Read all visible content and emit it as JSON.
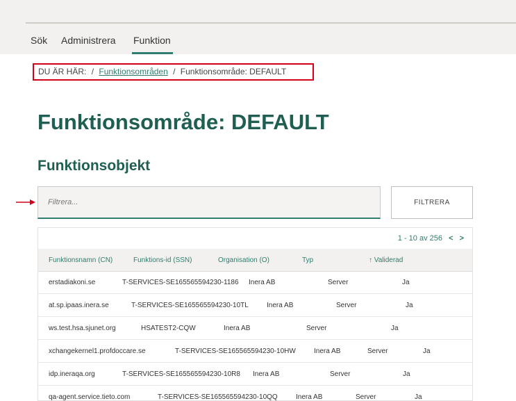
{
  "nav": {
    "items": [
      "Sök",
      "Administrera",
      "Funktion"
    ],
    "active": "Funktion"
  },
  "breadcrumb": {
    "prefix": "DU ÄR HÄR:",
    "separator": "/",
    "link": "Funktionsområden",
    "current": "Funktionsområde: DEFAULT"
  },
  "page": {
    "title": "Funktionsområde: DEFAULT",
    "section_title": "Funktionsobjekt"
  },
  "filter": {
    "placeholder": "Filtrera...",
    "button_label": "FILTRERA"
  },
  "pagination": {
    "label": "1 - 10 av 256",
    "prev": "<",
    "next": ">"
  },
  "table": {
    "columns": [
      "Funktionsnamn (CN)",
      "Funktions-id (SSN)",
      "Organisation (O)",
      "Typ",
      "Validerad"
    ],
    "sort_indicator": "↑",
    "rows": [
      [
        "erstadiakoni.se",
        "T-SERVICES-SE165565594230-1186",
        "Inera AB",
        "Server",
        "Ja"
      ],
      [
        "at.sp.ipaas.inera.se",
        "T-SERVICES-SE165565594230-10TL",
        "Inera AB",
        "Server",
        "Ja"
      ],
      [
        "ws.test.hsa.sjunet.org",
        "HSATEST2-CQW",
        "Inera AB",
        "Server",
        "Ja"
      ],
      [
        "xchangekernel1.profdoccare.se",
        "T-SERVICES-SE165565594230-10HW",
        "Inera AB",
        "Server",
        "Ja"
      ],
      [
        "idp.ineraqa.org",
        "T-SERVICES-SE165565594230-10R8",
        "Inera AB",
        "Server",
        "Ja"
      ],
      [
        "qa-agent.service.tieto.com",
        "T-SERVICES-SE165565594230-10QQ",
        "Inera AB",
        "Server",
        "Ja"
      ]
    ]
  },
  "colors": {
    "accent": "#2e7d6e",
    "heading": "#1f5f52",
    "highlight": "#d4001a"
  }
}
